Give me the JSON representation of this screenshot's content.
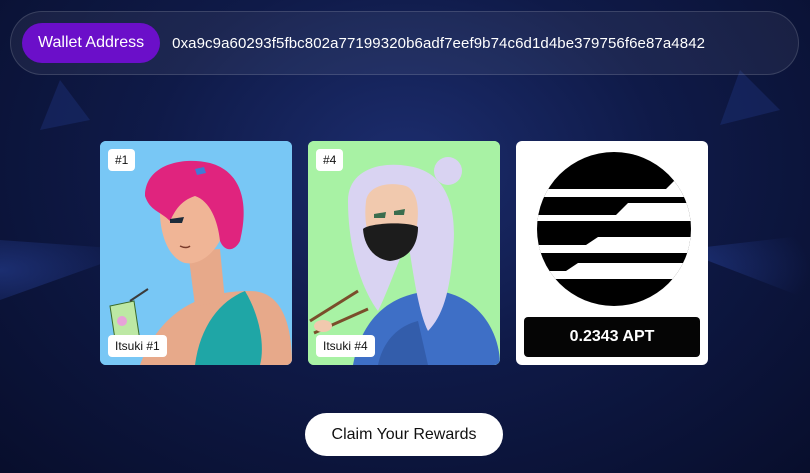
{
  "wallet": {
    "label": "Wallet Address",
    "address": "0xa9c9a60293f5fbc802a77199320b6adf7eef9b74c6d1d4be379756f6e87a4842"
  },
  "nfts": [
    {
      "number": "#1",
      "name": "Itsuki #1",
      "background": "#78c7f5"
    },
    {
      "number": "#4",
      "name": "Itsuki #4",
      "background": "#a8f2a4"
    }
  ],
  "token": {
    "icon": "aptos-logo-icon",
    "amount": "0.2343 APT"
  },
  "actions": {
    "claim_label": "Claim Your Rewards"
  },
  "colors": {
    "accent": "#6b0fc9",
    "background": "#0f1a48"
  }
}
